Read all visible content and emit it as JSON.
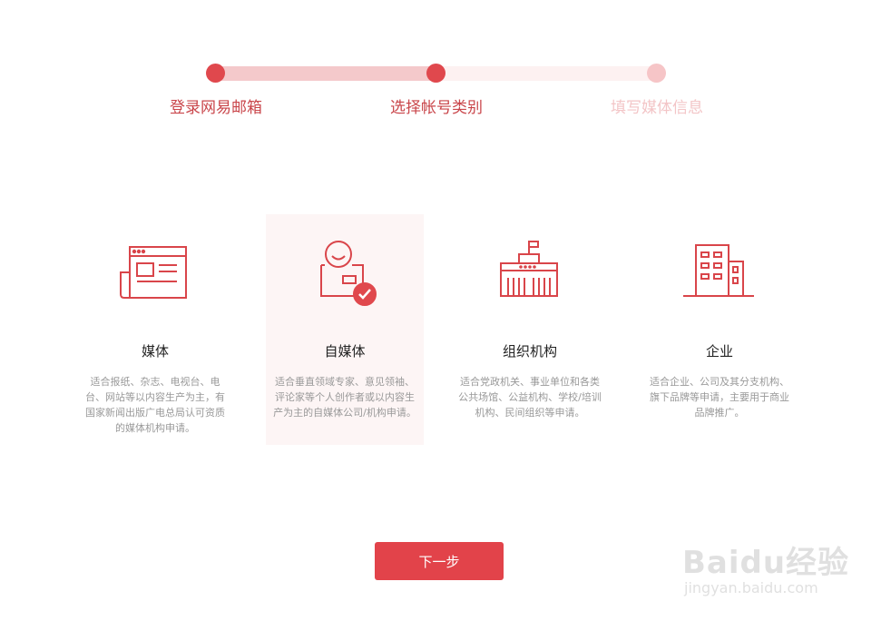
{
  "steps": [
    {
      "label": "登录网易邮箱",
      "state": "active"
    },
    {
      "label": "选择帐号类别",
      "state": "active"
    },
    {
      "label": "填写媒体信息",
      "state": "inactive"
    }
  ],
  "cards": [
    {
      "title": "媒体",
      "icon": "newspaper-icon",
      "selected": false,
      "desc": "适合报纸、杂志、电视台、电台、网站等以内容生产为主，有国家新闻出版广电总局认可资质的媒体机构申请。"
    },
    {
      "title": "自媒体",
      "icon": "person-check-icon",
      "selected": true,
      "desc": "适合垂直领域专家、意见领袖、评论家等个人创作者或以内容生产为主的自媒体公司/机构申请。"
    },
    {
      "title": "组织机构",
      "icon": "institution-building-icon",
      "selected": false,
      "desc": "适合党政机关、事业单位和各类公共场馆、公益机构、学校/培训机构、民间组织等申请。"
    },
    {
      "title": "企业",
      "icon": "office-building-icon",
      "selected": false,
      "desc": "适合企业、公司及其分支机构、旗下品牌等申请，主要用于商业品牌推广。"
    }
  ],
  "next_button": {
    "label": "下一步"
  },
  "watermark": {
    "line1": "Baidu经验",
    "line2": "jingyan.baidu.com"
  },
  "colors": {
    "accent": "#e0484d",
    "accent_light": "#f4c9cb",
    "selected_bg": "#fdf5f5",
    "button": "#e2434a"
  }
}
